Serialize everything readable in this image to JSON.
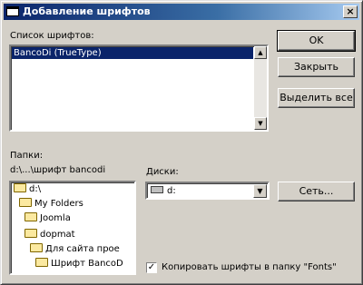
{
  "window": {
    "title": "Добавление шрифтов",
    "close_glyph": "×"
  },
  "font_list": {
    "label": "Список шрифтов:",
    "items": [
      "BancoDi (TrueType)"
    ],
    "selected_index": 0
  },
  "buttons": {
    "ok": "OK",
    "close": "Закрыть",
    "select_all": "Выделить все",
    "network": "Сеть..."
  },
  "folders": {
    "label": "Папки:",
    "current_path": "d:\\...\\шрифт bancodi",
    "tree": [
      {
        "label": "d:\\",
        "icon": "folder-open-icon"
      },
      {
        "label": "My Folders",
        "icon": "folder-open-icon"
      },
      {
        "label": "Joomla",
        "icon": "folder-open-icon"
      },
      {
        "label": "dopmat",
        "icon": "folder-open-icon"
      },
      {
        "label": "Для сайта прое",
        "icon": "folder-open-icon"
      },
      {
        "label": "Шрифт BancoD",
        "icon": "folder-open-icon"
      }
    ]
  },
  "drives": {
    "label": "Диски:",
    "selected": "d:",
    "icon": "drive-icon"
  },
  "copy_option": {
    "label": "Копировать шрифты в папку \"Fonts\"",
    "checked": true,
    "check_glyph": "✓"
  },
  "scroll_glyphs": {
    "up": "▲",
    "down": "▼"
  },
  "colors": {
    "face": "#d4d0c8",
    "title_start": "#0a246a",
    "selection": "#0a246a"
  }
}
